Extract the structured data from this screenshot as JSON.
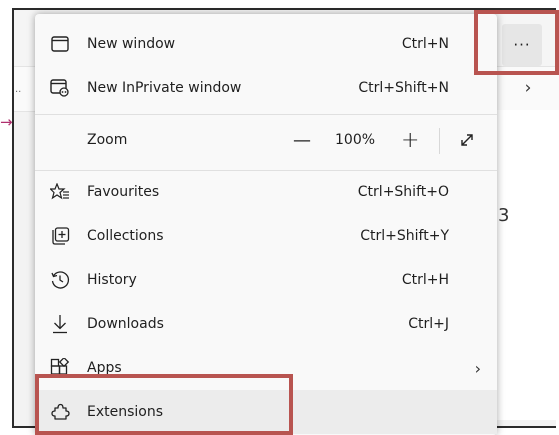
{
  "menu": {
    "items": [
      {
        "label": "New window",
        "shortcut": "Ctrl+N",
        "icon": "window-icon"
      },
      {
        "label": "New InPrivate window",
        "shortcut": "Ctrl+Shift+N",
        "icon": "inprivate-window-icon"
      },
      {
        "label": "Zoom",
        "icon": ""
      },
      {
        "label": "Favourites",
        "shortcut": "Ctrl+Shift+O",
        "icon": "favourites-icon"
      },
      {
        "label": "Collections",
        "shortcut": "Ctrl+Shift+Y",
        "icon": "collections-icon"
      },
      {
        "label": "History",
        "shortcut": "Ctrl+H",
        "icon": "history-icon"
      },
      {
        "label": "Downloads",
        "shortcut": "Ctrl+J",
        "icon": "downloads-icon"
      },
      {
        "label": "Apps",
        "icon": "apps-icon"
      },
      {
        "label": "Extensions",
        "icon": "extensions-icon"
      }
    ],
    "zoom": {
      "minus": "—",
      "value": "100%",
      "plus": "+"
    }
  },
  "toolbar": {
    "more_label": "···"
  },
  "background": {
    "char": "3"
  },
  "colors": {
    "menu_bg": "#f9f9f9",
    "highlight": "#ececec",
    "annotation": "#b85450"
  }
}
